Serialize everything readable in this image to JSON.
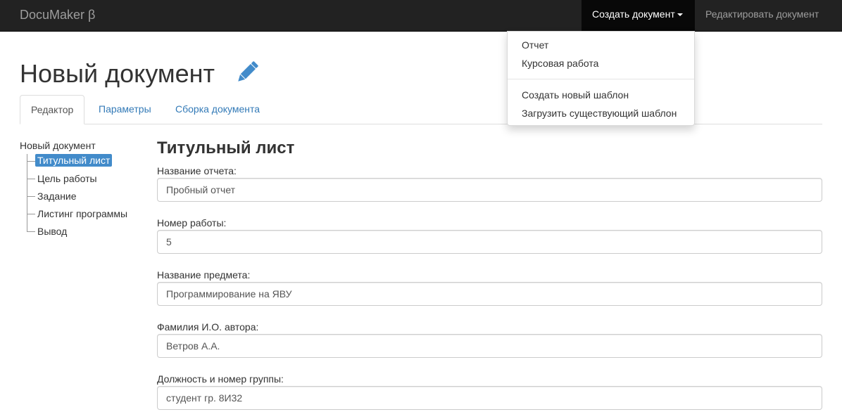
{
  "navbar": {
    "brand": "DocuMaker β",
    "create_label": "Создать документ",
    "edit_label": "Редактировать документ"
  },
  "dropdown": {
    "items": [
      "Отчет",
      "Курсовая работа",
      "Создать новый шаблон",
      "Загрузить существующий шаблон"
    ]
  },
  "page": {
    "title": "Новый документ",
    "icon": "pencil-icon"
  },
  "tabs": [
    "Редактор",
    "Параметры",
    "Сборка документа"
  ],
  "active_tab": "Редактор",
  "tree": {
    "root": "Новый документ",
    "items": [
      "Титульный лист",
      "Цель работы",
      "Задание",
      "Листинг программы",
      "Вывод"
    ],
    "selected": "Титульный лист"
  },
  "section": {
    "title": "Титульный лист"
  },
  "fields": [
    {
      "label": "Название отчета:",
      "value": "Пробный отчет"
    },
    {
      "label": "Номер работы:",
      "value": "5"
    },
    {
      "label": "Название предмета:",
      "value": "Программирование на ЯВУ"
    },
    {
      "label": "Фамилия И.О. автора:",
      "value": "Ветров А.А."
    },
    {
      "label": "Должность и номер группы:",
      "value": "студент гр. 8И32"
    }
  ],
  "colors": {
    "navbar_bg": "#222222",
    "accent": "#337ab7",
    "selected_bg": "#428bca"
  }
}
